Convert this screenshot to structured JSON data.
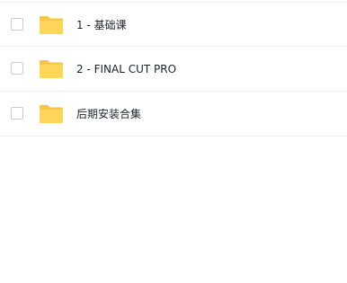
{
  "colors": {
    "folder_back": "#F5C443",
    "folder_front": "#FFD659",
    "text": "#1D2129",
    "divider": "#EEF0F4",
    "checkbox_border": "#C9CCD2"
  },
  "file_list": {
    "items": [
      {
        "name": "1 - 基础课",
        "icon": "folder-icon",
        "checked": false
      },
      {
        "name": "2 - FINAL CUT PRO",
        "icon": "folder-icon",
        "checked": false
      },
      {
        "name": "后期安装合集",
        "icon": "folder-icon",
        "checked": false
      }
    ]
  }
}
